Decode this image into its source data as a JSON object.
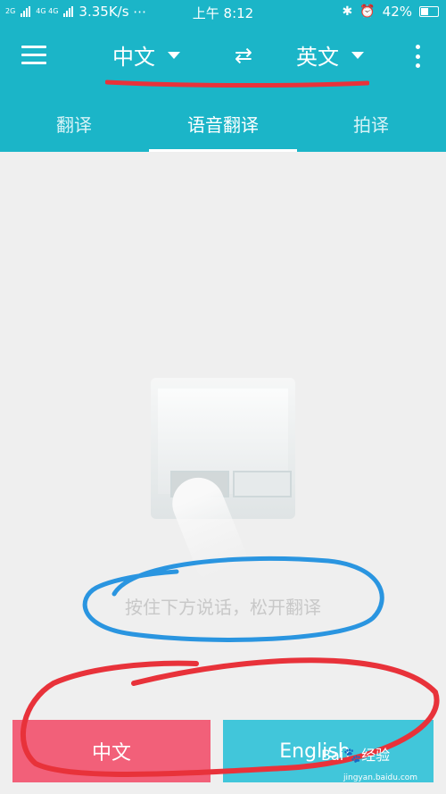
{
  "status_bar": {
    "network_left": "2G",
    "network_mid": "4G 4G",
    "speed": "3.35K/s ⋯",
    "time": "上午 8:12",
    "battery": "42%"
  },
  "toolbar": {
    "source_lang": "中文",
    "target_lang": "英文"
  },
  "tabs": [
    {
      "label": "翻译"
    },
    {
      "label": "语音翻译"
    },
    {
      "label": "拍译"
    }
  ],
  "main": {
    "hint": "按住下方说话，松开翻译"
  },
  "buttons": {
    "chinese": "中文",
    "english": "English"
  },
  "watermark": {
    "text": "Bai🐾经验",
    "url": "jingyan.baidu.com"
  },
  "colors": {
    "header": "#1bb5c8",
    "button_zh": "#f26079",
    "button_en": "#41c6da",
    "annotation_red": "#e8323a",
    "annotation_blue": "#2a95e0"
  }
}
